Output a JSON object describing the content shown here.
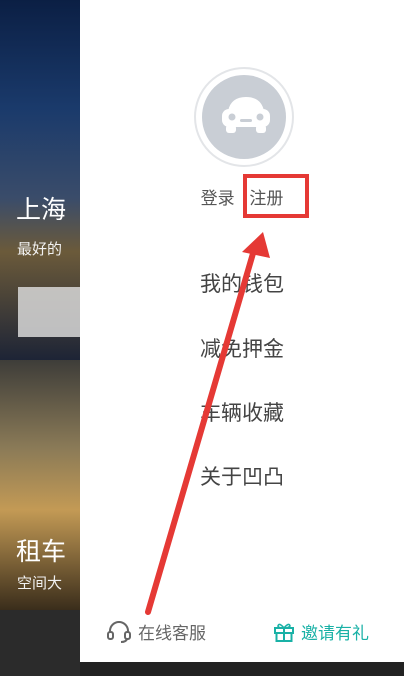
{
  "background_app": {
    "card1": {
      "title": "上海",
      "subtitle": "最好的"
    },
    "card2": {
      "title": "租车",
      "subtitle": "空间大"
    }
  },
  "drawer": {
    "login_label": "登录",
    "register_label": "注册",
    "menu": [
      {
        "label": "我的钱包"
      },
      {
        "label": "减免押金"
      },
      {
        "label": "车辆收藏"
      },
      {
        "label": "关于凹凸"
      }
    ],
    "support_label": "在线客服",
    "invite_label": "邀请有礼"
  },
  "colors": {
    "accent_teal": "#19b1a6",
    "annotation_red": "#e53935",
    "text_gray": "#444444"
  },
  "icons": {
    "avatar": "car-icon",
    "support": "headset-icon",
    "invite": "gift-icon"
  }
}
